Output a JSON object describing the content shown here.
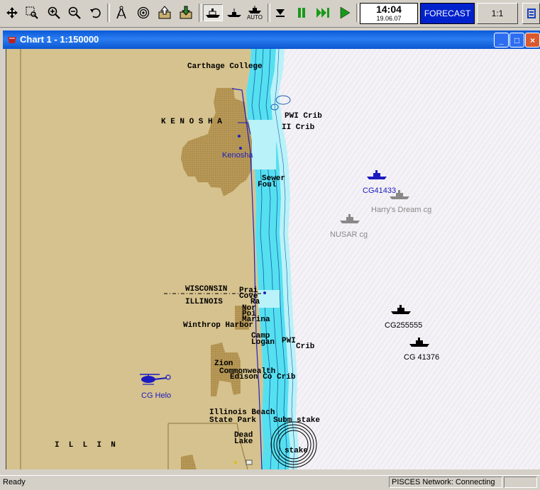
{
  "toolbar": {
    "icons": [
      "move-icon",
      "zoom-box-icon",
      "zoom-in-icon",
      "zoom-out-icon",
      "undo-icon",
      "compass-icon",
      "target-icon",
      "export-icon",
      "import-icon",
      "ship-view-icon",
      "ship-side-icon",
      "auto-icon",
      "download-icon",
      "pause-icon",
      "fast-forward-icon",
      "play-icon"
    ],
    "auto_label": "AUTO",
    "clock_time": "14:04",
    "clock_date": "19.06.07",
    "forecast_label": "FORECAST",
    "scale_label": "1:1"
  },
  "window": {
    "title": "Chart 1 - 1:150000",
    "minimize": "_",
    "maximize": "□",
    "close": "×"
  },
  "map": {
    "colors": {
      "land": "#d6c28e",
      "urban": "#b49554",
      "shallow_water": "#55e0f0",
      "deep_water": "#f4f2f6",
      "route": "#2020c0",
      "vessel_active": "#1a1ac0",
      "vessel_inactive": "#888888",
      "vessel_other": "#000000"
    },
    "labels": {
      "carthage": "Carthage College",
      "kenosha_caps": "K E N O S H A",
      "pwi_crib_1": "PWI Crib",
      "ii_crib": "II Crib",
      "kenosha_town": "Kenosha",
      "sewer": "Sewer",
      "foul": "Foul",
      "wisconsin": "WISCONSIN",
      "illinois": "ILLINOIS",
      "prai": "Prai",
      "cove": "Cove",
      "ra": "Ra",
      "nor": "Nor",
      "poi": "Poi",
      "marina": "Marina",
      "winthrop": "Winthrop Harbor",
      "camp": "Camp",
      "logan": "Logan",
      "pwi_crib_2a": "PWI",
      "pwi_crib_2b": "Crib",
      "zion": "Zion",
      "commonwealth": "Commonwealth",
      "edison": "Edison Co Crib",
      "il_beach": "Illinois Beach",
      "state_park": "State Park",
      "subm_stake": "Subm stake",
      "dead": "Dead",
      "lake": "Lake",
      "stake": "stake",
      "illin": "I  L  L  I  N"
    },
    "vessels": [
      {
        "name": "CG41433",
        "icon": "ship-icon",
        "state": "active"
      },
      {
        "name": "Harry's Dream cg",
        "icon": "ship-icon",
        "state": "inactive"
      },
      {
        "name": "NUSAR cg",
        "icon": "ship-icon",
        "state": "inactive"
      },
      {
        "name": "CG255555",
        "icon": "ship-icon",
        "state": "other"
      },
      {
        "name": "CG 41376",
        "icon": "ship-icon",
        "state": "other"
      },
      {
        "name": "CG Helo",
        "icon": "helicopter-icon",
        "state": "active"
      }
    ]
  },
  "status": {
    "left": "Ready",
    "right": "PISCES Network: Connecting"
  }
}
